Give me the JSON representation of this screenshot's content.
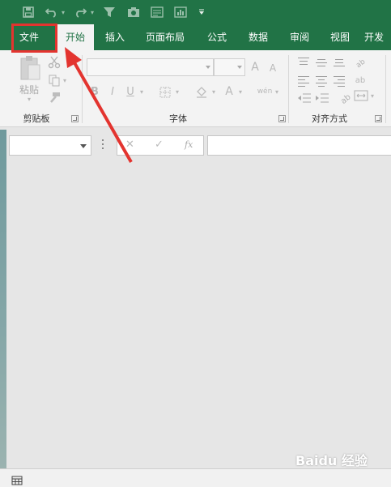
{
  "quick_access": {
    "icons": [
      "save-icon",
      "undo-icon",
      "redo-icon",
      "filter-icon",
      "camera-icon",
      "form-icon",
      "chart-icon",
      "customize-icon"
    ]
  },
  "tabs": [
    {
      "label": "文件",
      "active": false
    },
    {
      "label": "开始",
      "active": true
    },
    {
      "label": "插入",
      "active": false
    },
    {
      "label": "页面布局",
      "active": false
    },
    {
      "label": "公式",
      "active": false
    },
    {
      "label": "数据",
      "active": false
    },
    {
      "label": "审阅",
      "active": false
    },
    {
      "label": "视图",
      "active": false
    },
    {
      "label": "开发",
      "active": false
    }
  ],
  "ribbon": {
    "clipboard": {
      "paste_label": "粘贴",
      "group_label": "剪贴板"
    },
    "font": {
      "group_label": "字体",
      "font_size_increase": "A",
      "font_size_decrease": "A",
      "bold": "B",
      "italic": "I",
      "underline": "U",
      "font_color": "A",
      "phonetic": "wén"
    },
    "alignment": {
      "group_label": "对齐方式",
      "wrap": "ab"
    }
  },
  "formula_bar": {
    "cancel": "✕",
    "enter": "✓",
    "function": "fx",
    "name_box_value": "",
    "formula_value": ""
  },
  "watermark": "Baidu 经验",
  "colors": {
    "brand_green": "#217346",
    "highlight_red": "#e3342f"
  }
}
